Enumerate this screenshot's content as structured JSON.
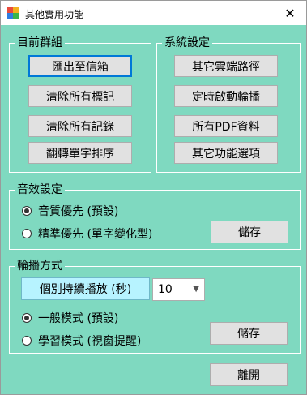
{
  "window": {
    "title": "其他實用功能",
    "close_symbol": "✕"
  },
  "group_target": {
    "label": "目前群組",
    "buttons": [
      "匯出至信箱",
      "清除所有標記",
      "清除所有記錄",
      "翻轉單字排序"
    ]
  },
  "group_system": {
    "label": "系統設定",
    "buttons": [
      "其它雲端路徑",
      "定時啟動輪播",
      "所有PDF資料",
      "其它功能選項"
    ]
  },
  "group_sound": {
    "label": "音效設定",
    "options": [
      "音質優先 (預設)",
      "精準優先 (單字變化型)"
    ],
    "selected_index": 0,
    "save_label": "儲存"
  },
  "group_playback": {
    "label": "輪播方式",
    "duration_label": "個別持續播放 (秒)",
    "duration_value": "10",
    "options": [
      "一般模式 (預設)",
      "學習模式 (視窗提醒)"
    ],
    "selected_index": 0,
    "save_label": "儲存"
  },
  "exit_label": "離開"
}
